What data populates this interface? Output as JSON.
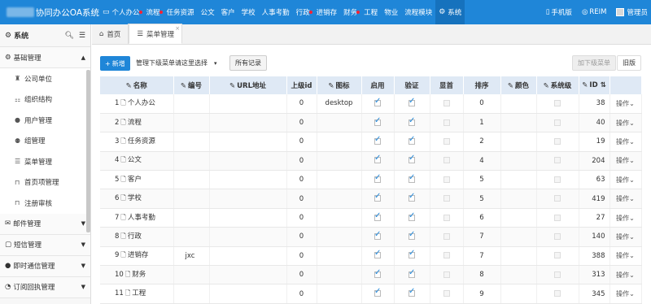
{
  "brand": {
    "title": "协同办公OA系统"
  },
  "nav": [
    {
      "label": "个人办公",
      "icon": "monitor-icon",
      "dot": true
    },
    {
      "label": "流程",
      "dot": true
    },
    {
      "label": "任务资源",
      "dot": false
    },
    {
      "label": "公文",
      "dot": false
    },
    {
      "label": "客户",
      "dot": false
    },
    {
      "label": "学校",
      "dot": false
    },
    {
      "label": "人事考勤",
      "dot": false
    },
    {
      "label": "行政",
      "dot": true
    },
    {
      "label": "进销存",
      "dot": false
    },
    {
      "label": "财务",
      "dot": true
    },
    {
      "label": "工程",
      "dot": false
    },
    {
      "label": "物业",
      "dot": false
    },
    {
      "label": "流程模块",
      "dot": false
    },
    {
      "label": "系统",
      "icon": "gear-icon",
      "dot": false,
      "active": true
    }
  ],
  "top_right": {
    "mobile": "手机版",
    "reim": "REIM",
    "user": "管理员"
  },
  "sidebar": {
    "title": "系统",
    "groups": [
      {
        "label": "基础管理",
        "expanded": true,
        "items": [
          {
            "label": "公司单位",
            "icon": "sitemap-icon"
          },
          {
            "label": "组织结构",
            "icon": "org-icon"
          },
          {
            "label": "用户管理",
            "icon": "user-icon"
          },
          {
            "label": "组管理",
            "icon": "users-icon"
          },
          {
            "label": "菜单管理",
            "icon": "list-icon"
          },
          {
            "label": "首页项管理",
            "icon": "bookmark-icon"
          },
          {
            "label": "注册审核",
            "icon": "bookmark-icon"
          }
        ]
      },
      {
        "label": "邮件管理",
        "icon": "envelope-icon"
      },
      {
        "label": "短信管理",
        "icon": "comment-icon"
      },
      {
        "label": "即时通信管理",
        "icon": "chat-icon"
      },
      {
        "label": "订阅回执管理",
        "icon": "rss-icon"
      }
    ]
  },
  "tabs": [
    {
      "label": "首页",
      "icon": "home-icon"
    },
    {
      "label": "菜单管理",
      "icon": "list-icon",
      "active": true
    }
  ],
  "toolbar": {
    "add_label": "新增",
    "select_label": "管理下级菜单请这里选择",
    "all_label": "所有记录",
    "next_label": "加下级菜单",
    "old_label": "旧版"
  },
  "table": {
    "columns": [
      "名称",
      "编号",
      "URL地址",
      "上级id",
      "图标",
      "启用",
      "验证",
      "显首",
      "排序",
      "颜色",
      "系统级",
      "ID"
    ],
    "op_label": "操作",
    "rows": [
      {
        "no": "1",
        "name": "个人办公",
        "code": "",
        "url": "",
        "pid": "0",
        "icon": "desktop",
        "enabled": true,
        "verify": true,
        "home": false,
        "sort": "0",
        "color": "",
        "sys": false,
        "id": "38"
      },
      {
        "no": "2",
        "name": "流程",
        "code": "",
        "url": "",
        "pid": "0",
        "icon": "",
        "enabled": true,
        "verify": true,
        "home": false,
        "sort": "1",
        "color": "",
        "sys": false,
        "id": "40"
      },
      {
        "no": "3",
        "name": "任务资源",
        "code": "",
        "url": "",
        "pid": "0",
        "icon": "",
        "enabled": true,
        "verify": true,
        "home": false,
        "sort": "2",
        "color": "",
        "sys": false,
        "id": "19"
      },
      {
        "no": "4",
        "name": "公文",
        "code": "",
        "url": "",
        "pid": "0",
        "icon": "",
        "enabled": true,
        "verify": true,
        "home": false,
        "sort": "4",
        "color": "",
        "sys": false,
        "id": "204"
      },
      {
        "no": "5",
        "name": "客户",
        "code": "",
        "url": "",
        "pid": "0",
        "icon": "",
        "enabled": true,
        "verify": true,
        "home": false,
        "sort": "5",
        "color": "",
        "sys": false,
        "id": "63"
      },
      {
        "no": "6",
        "name": "学校",
        "code": "",
        "url": "",
        "pid": "0",
        "icon": "",
        "enabled": true,
        "verify": true,
        "home": false,
        "sort": "5",
        "color": "",
        "sys": false,
        "id": "419"
      },
      {
        "no": "7",
        "name": "人事考勤",
        "code": "",
        "url": "",
        "pid": "0",
        "icon": "",
        "enabled": true,
        "verify": true,
        "home": false,
        "sort": "6",
        "color": "",
        "sys": false,
        "id": "27"
      },
      {
        "no": "8",
        "name": "行政",
        "code": "",
        "url": "",
        "pid": "0",
        "icon": "",
        "enabled": true,
        "verify": true,
        "home": false,
        "sort": "7",
        "color": "",
        "sys": false,
        "id": "140"
      },
      {
        "no": "9",
        "name": "进销存",
        "code": "jxc",
        "url": "",
        "pid": "0",
        "icon": "",
        "enabled": true,
        "verify": true,
        "home": false,
        "sort": "7",
        "color": "",
        "sys": false,
        "id": "388"
      },
      {
        "no": "10",
        "name": "财务",
        "code": "",
        "url": "",
        "pid": "0",
        "icon": "",
        "enabled": true,
        "verify": true,
        "home": false,
        "sort": "8",
        "color": "",
        "sys": false,
        "id": "313"
      },
      {
        "no": "11",
        "name": "工程",
        "code": "",
        "url": "",
        "pid": "0",
        "icon": "",
        "enabled": true,
        "verify": true,
        "home": false,
        "sort": "9",
        "color": "",
        "sys": false,
        "id": "345"
      }
    ]
  }
}
